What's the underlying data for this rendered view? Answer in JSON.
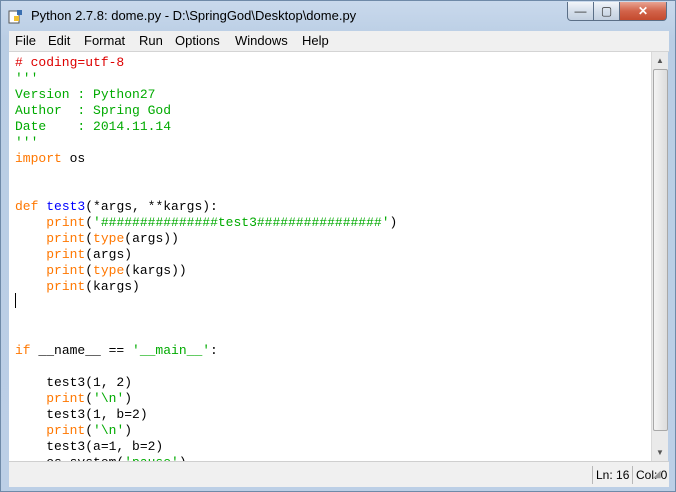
{
  "window": {
    "title": "Python 2.7.8: dome.py - D:\\SpringGod\\Desktop\\dome.py",
    "controls": {
      "minimize": "—",
      "maximize": "▢",
      "close": "✕"
    }
  },
  "menubar": [
    "File",
    "Edit",
    "Format",
    "Run",
    "Options",
    "Windows",
    "Help"
  ],
  "colors": {
    "comment": "#dd0000",
    "string": "#00aa00",
    "keyword": "#ff7700",
    "definition": "#0000ff",
    "plain": "#000000"
  },
  "code": [
    [
      [
        "# coding=utf-8",
        "comment"
      ]
    ],
    [
      [
        "'''",
        "string"
      ]
    ],
    [
      [
        "Version : Python27",
        "string"
      ]
    ],
    [
      [
        "Author  : Spring God",
        "string"
      ]
    ],
    [
      [
        "Date    : 2014.11.14",
        "string"
      ]
    ],
    [
      [
        "'''",
        "string"
      ]
    ],
    [
      [
        "import",
        "keyword"
      ],
      [
        " os",
        "plain"
      ]
    ],
    [],
    [],
    [
      [
        "def",
        "keyword"
      ],
      [
        " ",
        "plain"
      ],
      [
        "test3",
        "definition"
      ],
      [
        "(*args, **kargs):",
        "plain"
      ]
    ],
    [
      [
        "    ",
        "plain"
      ],
      [
        "print",
        "keyword"
      ],
      [
        "(",
        "plain"
      ],
      [
        "'###############test3################'",
        "string"
      ],
      [
        ")",
        "plain"
      ]
    ],
    [
      [
        "    ",
        "plain"
      ],
      [
        "print",
        "keyword"
      ],
      [
        "(",
        "plain"
      ],
      [
        "type",
        "keyword"
      ],
      [
        "(args))",
        "plain"
      ]
    ],
    [
      [
        "    ",
        "plain"
      ],
      [
        "print",
        "keyword"
      ],
      [
        "(args)",
        "plain"
      ]
    ],
    [
      [
        "    ",
        "plain"
      ],
      [
        "print",
        "keyword"
      ],
      [
        "(",
        "plain"
      ],
      [
        "type",
        "keyword"
      ],
      [
        "(kargs))",
        "plain"
      ]
    ],
    [
      [
        "    ",
        "plain"
      ],
      [
        "print",
        "keyword"
      ],
      [
        "(kargs)",
        "plain"
      ]
    ],
    [],
    [],
    [],
    [
      [
        "if",
        "keyword"
      ],
      [
        " __name__ == ",
        "plain"
      ],
      [
        "'__main__'",
        "string"
      ],
      [
        ":",
        "plain"
      ]
    ],
    [],
    [
      [
        "    test3(1, 2)",
        "plain"
      ]
    ],
    [
      [
        "    ",
        "plain"
      ],
      [
        "print",
        "keyword"
      ],
      [
        "(",
        "plain"
      ],
      [
        "'\\n'",
        "string"
      ],
      [
        ")",
        "plain"
      ]
    ],
    [
      [
        "    test3(1, b=2)",
        "plain"
      ]
    ],
    [
      [
        "    ",
        "plain"
      ],
      [
        "print",
        "keyword"
      ],
      [
        "(",
        "plain"
      ],
      [
        "'\\n'",
        "string"
      ],
      [
        ")",
        "plain"
      ]
    ],
    [
      [
        "    test3(a=1, b=2)",
        "plain"
      ]
    ],
    [
      [
        "    os.system(",
        "plain"
      ],
      [
        "'pause'",
        "string"
      ],
      [
        ")",
        "plain"
      ]
    ]
  ],
  "status": {
    "line": "Ln: 16",
    "col": "Col: 0"
  },
  "icons": {
    "app": "python-idle-icon",
    "scroll_up": "scroll-up-arrow-icon",
    "scroll_down": "scroll-down-arrow-icon",
    "grip": "resize-grip-icon"
  }
}
